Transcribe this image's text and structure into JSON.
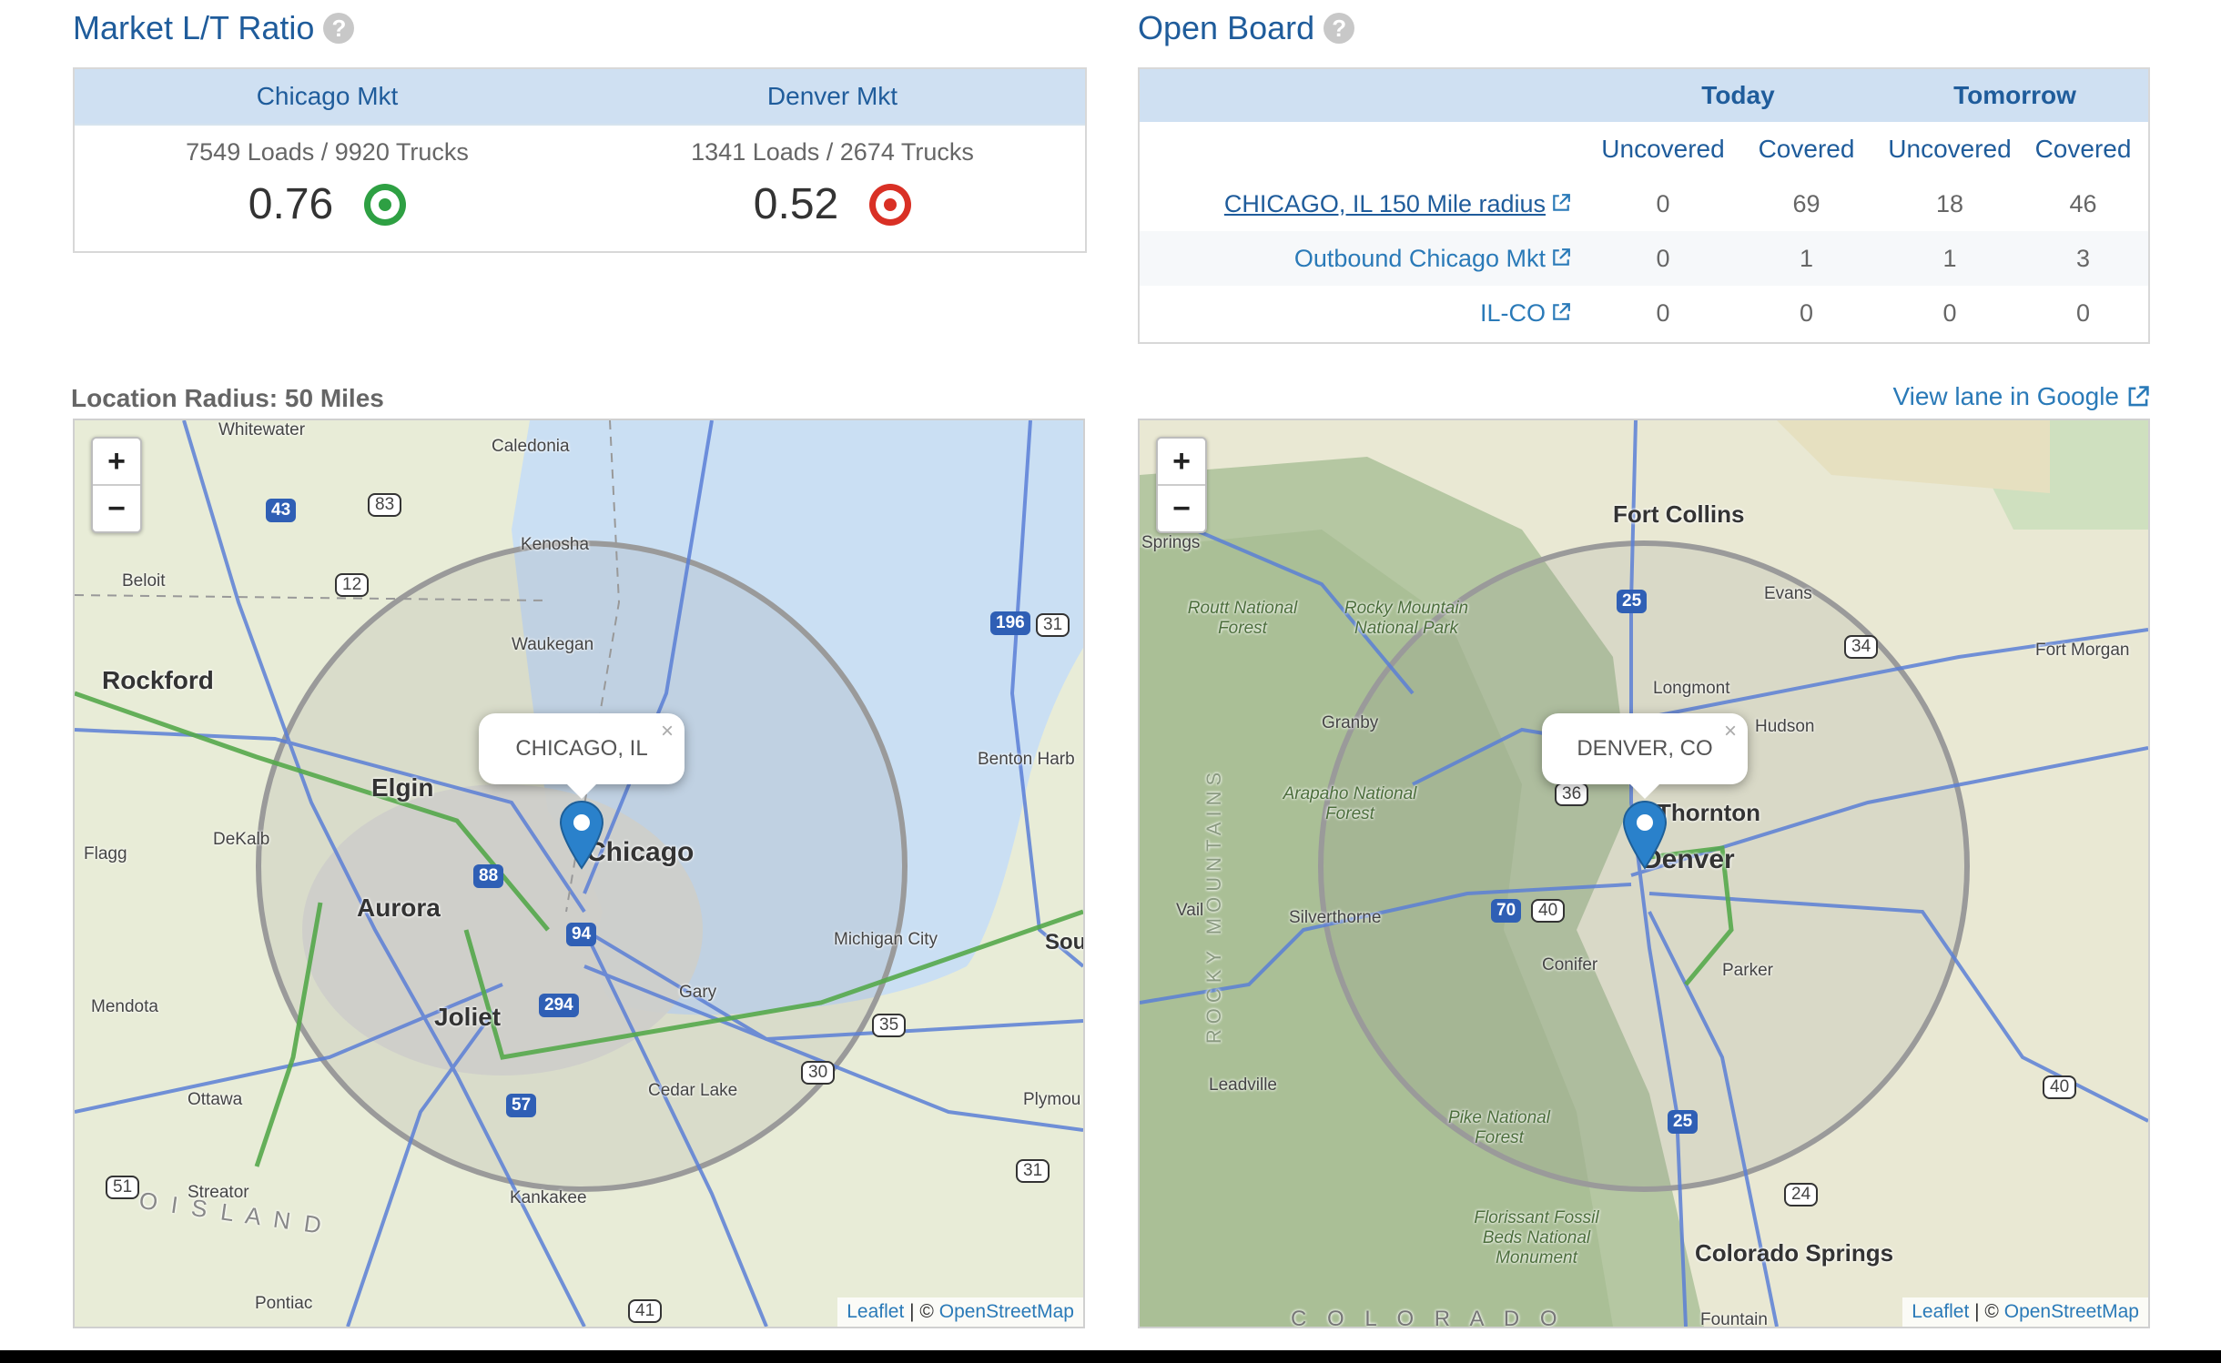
{
  "lt": {
    "title": "Market L/T Ratio",
    "help": "?",
    "markets": [
      {
        "name": "Chicago Mkt",
        "counts": "7549 Loads / 9920 Trucks",
        "ratio": "0.76",
        "status_color": "#2ea043"
      },
      {
        "name": "Denver Mkt",
        "counts": "1341 Loads / 2674 Trucks",
        "ratio": "0.52",
        "status_color": "#d93025"
      }
    ]
  },
  "openboard": {
    "title": "Open Board",
    "help": "?",
    "groups": [
      "Today",
      "Tomorrow"
    ],
    "subheaders": [
      "Uncovered",
      "Covered",
      "Uncovered",
      "Covered"
    ],
    "rows": [
      {
        "lane": "CHICAGO, IL 150 Mile radius",
        "values": [
          "0",
          "69",
          "18",
          "46"
        ]
      },
      {
        "lane": "Outbound Chicago Mkt",
        "values": [
          "0",
          "1",
          "1",
          "3"
        ]
      },
      {
        "lane": "IL-CO",
        "values": [
          "0",
          "0",
          "0",
          "0"
        ]
      }
    ]
  },
  "left_map": {
    "radius_label": "Location Radius: 50 Miles",
    "zoom_in": "+",
    "zoom_out": "−",
    "popup": "CHICAGO, IL",
    "close": "×",
    "attribution_leaflet": "Leaflet",
    "attribution_sep": " | © ",
    "attribution_osm": "OpenStreetMap",
    "labels": {
      "chicago": "Chicago",
      "rockford": "Rockford",
      "elgin": "Elgin",
      "aurora": "Aurora",
      "joliet": "Joliet",
      "whitewater": "Whitewater",
      "caledonia": "Caledonia",
      "kenosha": "Kenosha",
      "beloit": "Beloit",
      "waukegan": "Waukegan",
      "dekalb": "DeKalb",
      "flagg": "Flagg",
      "mendota": "Mendota",
      "ottawa": "Ottawa",
      "streator": "Streator",
      "kankakee": "Kankakee",
      "pontiac": "Pontiac",
      "gary": "Gary",
      "cedar_lake": "Cedar Lake",
      "michigan_city": "Michigan City",
      "benton": "Benton Harb",
      "plymouth": "Plymou",
      "south": "Sou",
      "illinois": "O I S L A N D"
    },
    "shields": [
      "43",
      "83",
      "12",
      "196",
      "31",
      "88",
      "94",
      "294",
      "57",
      "35",
      "30",
      "31",
      "51",
      "41"
    ]
  },
  "right_map": {
    "view_lane_link": "View lane in Google",
    "zoom_in": "+",
    "zoom_out": "−",
    "popup": "DENVER, CO",
    "close": "×",
    "attribution_leaflet": "Leaflet",
    "attribution_sep": " | © ",
    "attribution_osm": "OpenStreetMap",
    "labels": {
      "denver": "Denver",
      "fort_collins": "Fort Collins",
      "springs": "Springs",
      "thornton": "Thornton",
      "colorado_springs": "Colorado Springs",
      "evans": "Evans",
      "fort_morgan": "Fort Morgan",
      "longmont": "Longmont",
      "hudson": "Hudson",
      "granby": "Granby",
      "vail": "Vail",
      "silverthorne": "Silverthorne",
      "conifer": "Conifer",
      "parker": "Parker",
      "leadville": "Leadville",
      "fountain": "Fountain",
      "routt": "Routt National Forest",
      "rmnp": "Rocky Mountain National Park",
      "arapaho": "Arapaho National Forest",
      "pike": "Pike National Forest",
      "florissant": "Florissant Fossil Beds National Monument",
      "rockies": "ROCKY MOUNTAINS",
      "colorado": "C O L O R A D O"
    },
    "shields": [
      "25",
      "34",
      "36",
      "70",
      "40",
      "25",
      "24",
      "40"
    ]
  }
}
